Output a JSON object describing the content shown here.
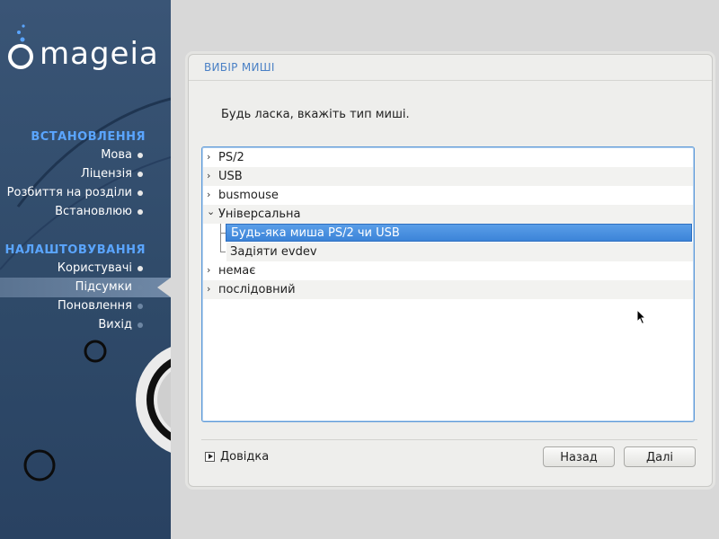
{
  "sidebar": {
    "logo_text": "mageia",
    "sections": [
      {
        "title": "ВСТАНОВЛЕННЯ",
        "steps": [
          "Мова",
          "Ліцензія",
          "Розбиття на розділи",
          "Встановлюю"
        ]
      },
      {
        "title": "НАЛАШТОВУВАННЯ",
        "steps": [
          "Користувачі",
          "Підсумки",
          "Поновлення",
          "Вихід"
        ]
      }
    ],
    "active_step": "Підсумки"
  },
  "main": {
    "title": "ВИБІР МИШІ",
    "instruction": "Будь ласка, вкажіть тип миші.",
    "tree": [
      {
        "label": "PS/2",
        "expanded": false
      },
      {
        "label": "USB",
        "expanded": false
      },
      {
        "label": "busmouse",
        "expanded": false
      },
      {
        "label": "Універсальна",
        "expanded": true,
        "children": [
          "Будь-яка миша PS/2 чи USB",
          "Задіяти evdev"
        ]
      },
      {
        "label": "немає",
        "expanded": false
      },
      {
        "label": "послідовний",
        "expanded": false
      }
    ],
    "selected": "Будь-яка миша PS/2 чи USB"
  },
  "footer": {
    "help_label": "Довідка",
    "back_label": "Назад",
    "next_label": "Далі"
  },
  "icons": {
    "collapsed": "›",
    "expanded": "⌄"
  },
  "colors": {
    "accent": "#5aa5ff",
    "selection": "#3c84d8",
    "sidebar_bg": "#2f4a69"
  }
}
